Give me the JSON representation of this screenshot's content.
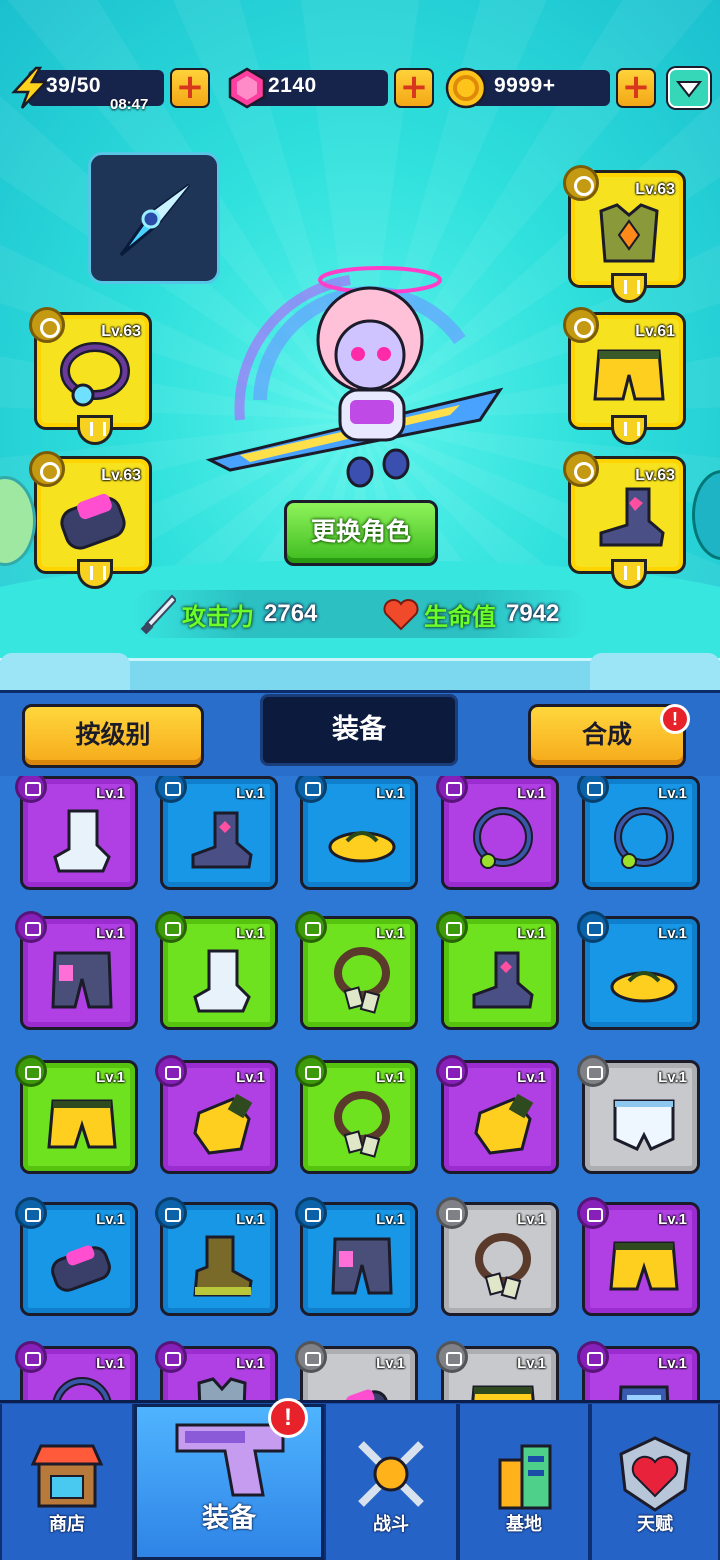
{
  "resources": {
    "energy": {
      "value": "39/50",
      "timer": "08:47",
      "icon": "lightning-icon"
    },
    "gems": {
      "value": "2140",
      "icon": "pink-gem-icon"
    },
    "coins": {
      "value": "9999+",
      "icon": "gold-coin-icon"
    },
    "plus_label": "+"
  },
  "equipment_slots": {
    "weapon": {
      "icon": "crystal-dagger-icon"
    },
    "necklace": {
      "level": "Lv.63",
      "icon": "necklace-icon"
    },
    "gloves": {
      "level": "Lv.63",
      "icon": "gloves-icon"
    },
    "armor": {
      "level": "Lv.63",
      "icon": "armor-vest-icon"
    },
    "pants": {
      "level": "Lv.61",
      "icon": "shorts-icon"
    },
    "boots": {
      "level": "Lv.63",
      "icon": "boots-icon"
    }
  },
  "character": {
    "swap_button": "更换角色",
    "attack_label": "攻击力",
    "attack_value": "2764",
    "hp_label": "生命值",
    "hp_value": "7942"
  },
  "inventory": {
    "sort_button": "按级别",
    "tab_label": "装备",
    "merge_button": "合成",
    "merge_badge": "!",
    "items": [
      {
        "level": "Lv.1",
        "rarity": "purple",
        "icon": "sock-icon"
      },
      {
        "level": "Lv.1",
        "rarity": "blue",
        "icon": "boots-icon"
      },
      {
        "level": "Lv.1",
        "rarity": "blue",
        "icon": "flip-flops-icon"
      },
      {
        "level": "Lv.1",
        "rarity": "purple",
        "icon": "necklace-icon"
      },
      {
        "level": "Lv.1",
        "rarity": "blue",
        "icon": "necklace-icon"
      },
      {
        "level": "Lv.1",
        "rarity": "purple",
        "icon": "armored-pants-icon"
      },
      {
        "level": "Lv.1",
        "rarity": "green",
        "icon": "sock-icon"
      },
      {
        "level": "Lv.1",
        "rarity": "green",
        "icon": "dogtag-necklace-icon"
      },
      {
        "level": "Lv.1",
        "rarity": "green",
        "icon": "boots-icon"
      },
      {
        "level": "Lv.1",
        "rarity": "blue",
        "icon": "flip-flops-icon"
      },
      {
        "level": "Lv.1",
        "rarity": "green",
        "icon": "shorts-icon"
      },
      {
        "level": "Lv.1",
        "rarity": "purple",
        "icon": "glove-icon"
      },
      {
        "level": "Lv.1",
        "rarity": "green",
        "icon": "dogtag-necklace-icon"
      },
      {
        "level": "Lv.1",
        "rarity": "purple",
        "icon": "glove-icon"
      },
      {
        "level": "Lv.1",
        "rarity": "gray",
        "icon": "briefs-icon"
      },
      {
        "level": "Lv.1",
        "rarity": "blue",
        "icon": "gauntlet-icon"
      },
      {
        "level": "Lv.1",
        "rarity": "blue",
        "icon": "combat-boot-icon"
      },
      {
        "level": "Lv.1",
        "rarity": "blue",
        "icon": "armored-pants-icon"
      },
      {
        "level": "Lv.1",
        "rarity": "gray",
        "icon": "dogtag-necklace-icon"
      },
      {
        "level": "Lv.1",
        "rarity": "purple",
        "icon": "shorts-icon"
      },
      {
        "level": "Lv.1",
        "rarity": "purple",
        "icon": "necklace-icon"
      },
      {
        "level": "Lv.1",
        "rarity": "purple",
        "icon": "vest-icon"
      },
      {
        "level": "Lv.1",
        "rarity": "gray",
        "icon": "gauntlet-icon"
      },
      {
        "level": "Lv.1",
        "rarity": "gray",
        "icon": "shorts-icon"
      },
      {
        "level": "Lv.1",
        "rarity": "purple",
        "icon": "armor-icon"
      }
    ]
  },
  "nav": {
    "shop": "商店",
    "equipment": "装备",
    "battle": "战斗",
    "base": "基地",
    "talent": "天赋",
    "equipment_badge": "!"
  },
  "colors": {
    "rarity_purple": "#b03fe4",
    "rarity_blue": "#1797e6",
    "rarity_green": "#6fe21f",
    "rarity_gray": "#c7c9cc",
    "legendary_yellow": "#f6e21f",
    "hero_bg": "#2fe0dc"
  }
}
